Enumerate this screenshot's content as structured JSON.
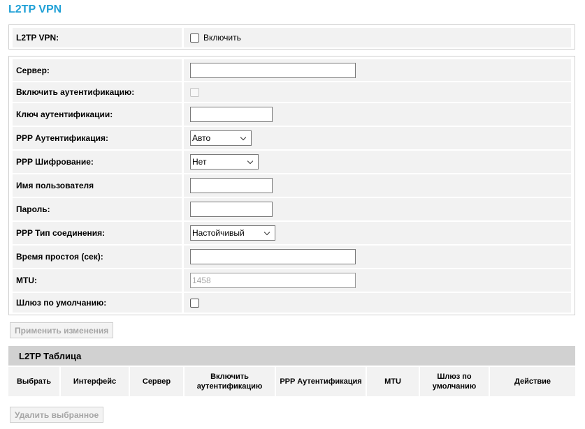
{
  "page_title": "L2TP VPN",
  "enable_section": {
    "label": "L2TP VPN:",
    "checkbox_label": "Включить",
    "checked": false
  },
  "settings": {
    "server_label": "Сервер:",
    "server_value": "",
    "auth_enable_label": "Включить аутентификацию:",
    "auth_enable_checked": false,
    "auth_key_label": "Ключ аутентификации:",
    "auth_key_value": "",
    "ppp_auth_label": "PPP Аутентификация:",
    "ppp_auth_value": "Авто",
    "ppp_encryption_label": "PPP Шифрование:",
    "ppp_encryption_value": "Нет",
    "username_label": "Имя пользователя",
    "username_value": "",
    "password_label": "Пароль:",
    "password_value": "",
    "ppp_conn_type_label": "PPP Тип соединения:",
    "ppp_conn_type_value": "Настойчивый",
    "idle_time_label": "Время простоя (сек):",
    "idle_time_value": "",
    "mtu_label": "MTU:",
    "mtu_placeholder": "1458",
    "default_gw_label": "Шлюз по умолчанию:",
    "default_gw_checked": false
  },
  "apply_button": "Применить изменения",
  "table": {
    "title": "L2TP Таблица",
    "columns": [
      "Выбрать",
      "Интерфейс",
      "Сервер",
      "Включить аутентификацию",
      "PPP Аутентификация",
      "MTU",
      "Шлюз по умолчанию",
      "Действие"
    ],
    "rows": []
  },
  "delete_button": "Удалить выбранное",
  "colors": {
    "title": "#1fa0d6",
    "row_bg": "#f2f2f2",
    "table_header_bg": "#d1d1d1"
  }
}
